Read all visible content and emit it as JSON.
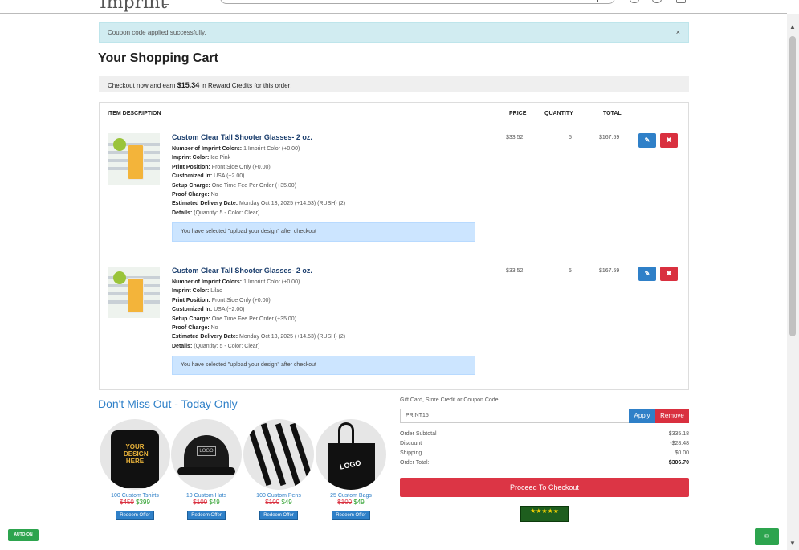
{
  "header": {
    "logo_text": "Imprint",
    "search_placeholder": ""
  },
  "alert": {
    "message": "Coupon code applied successfully.",
    "close_label": "×"
  },
  "page_title": "Your Shopping Cart",
  "reward": {
    "prefix": "Checkout now and earn ",
    "amount": "$15.34",
    "suffix": " in Reward Credits for this order!"
  },
  "cart": {
    "columns": {
      "description": "ITEM DESCRIPTION",
      "price": "PRICE",
      "quantity": "QUANTITY",
      "total": "TOTAL"
    },
    "items": [
      {
        "title": "Custom Clear Tall Shooter Glasses- 2 oz.",
        "options": [
          {
            "k": "Number of Imprint Colors:",
            "v": "1 Imprint Color (+0.00)"
          },
          {
            "k": "Imprint Color:",
            "v": "Ice Pink"
          },
          {
            "k": "Print Position:",
            "v": "Front Side Only (+0.00)"
          },
          {
            "k": "Customized In:",
            "v": "USA (+2.00)"
          },
          {
            "k": "Setup Charge:",
            "v": "One Time Fee Per Order (+35.00)"
          },
          {
            "k": "Proof Charge:",
            "v": "No"
          },
          {
            "k": "Estimated Delivery Date:",
            "v": "Monday Oct 13, 2025 (+14.53) (RUSH) (2)"
          },
          {
            "k": "Details:",
            "v": "(Quantity: 5 - Color: Clear)"
          }
        ],
        "upload_note": "You have selected \"upload your design\" after checkout",
        "price": "$33.52",
        "quantity": "5",
        "total": "$167.59"
      },
      {
        "title": "Custom Clear Tall Shooter Glasses- 2 oz.",
        "options": [
          {
            "k": "Number of Imprint Colors:",
            "v": "1 Imprint Color (+0.00)"
          },
          {
            "k": "Imprint Color:",
            "v": "Lilac"
          },
          {
            "k": "Print Position:",
            "v": "Front Side Only (+0.00)"
          },
          {
            "k": "Customized In:",
            "v": "USA (+2.00)"
          },
          {
            "k": "Setup Charge:",
            "v": "One Time Fee Per Order (+35.00)"
          },
          {
            "k": "Proof Charge:",
            "v": "No"
          },
          {
            "k": "Estimated Delivery Date:",
            "v": "Monday Oct 13, 2025 (+14.53) (RUSH) (2)"
          },
          {
            "k": "Details:",
            "v": "(Quantity: 5 - Color: Clear)"
          }
        ],
        "upload_note": "You have selected \"upload your design\" after checkout",
        "price": "$33.52",
        "quantity": "5",
        "total": "$167.59"
      }
    ],
    "edit_icon": "pencil-icon",
    "delete_icon": "x-icon"
  },
  "offers": {
    "title": "Don't Miss Out - Today Only",
    "redeem_label": "Redeem Offer",
    "items": [
      {
        "name": "100 Custom Tshirts",
        "old_price": "$450",
        "new_price": "$399"
      },
      {
        "name": "10 Custom Hats",
        "old_price": "$100",
        "new_price": "$49"
      },
      {
        "name": "100 Custom Pens",
        "old_price": "$100",
        "new_price": "$49"
      },
      {
        "name": "25 Custom Bags",
        "old_price": "$100",
        "new_price": "$49"
      }
    ]
  },
  "giftcard": {
    "label": "Gift Card, Store Credit or Coupon Code:",
    "value": "PRINT15",
    "apply_label": "Apply",
    "remove_label": "Remove"
  },
  "summary": {
    "rows": [
      {
        "label": "Order Subtotal",
        "value": "$335.18"
      },
      {
        "label": "Discount",
        "value": "-$28.48"
      },
      {
        "label": "Shipping",
        "value": "$0.00"
      },
      {
        "label": "Order Total:",
        "value": "$306.70"
      }
    ],
    "checkout_label": "Proceed To Checkout"
  },
  "trust_badge": {
    "stars": "★★★★★"
  },
  "widgets": {
    "autoon_label": "AUTO-ON",
    "chat_label": "✉"
  },
  "colors": {
    "primary_blue": "#2f80c8",
    "danger_red": "#dc3545",
    "success_green": "#2da44e"
  }
}
